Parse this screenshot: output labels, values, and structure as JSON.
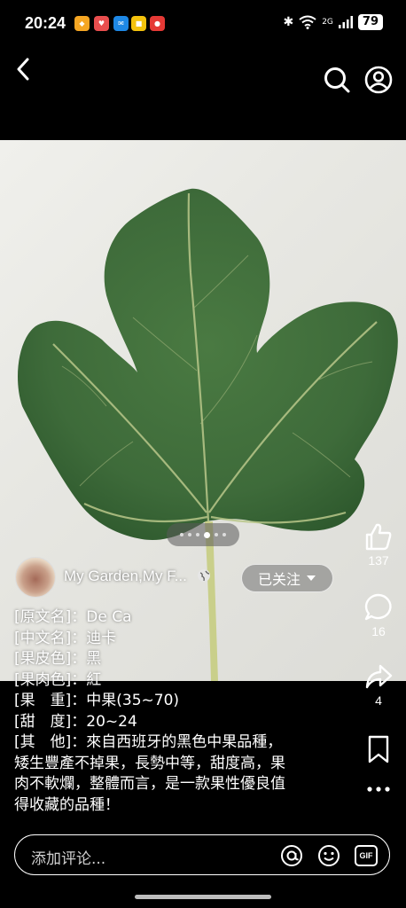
{
  "status": {
    "time": "20:24",
    "apps": [
      {
        "icon": "app-orange-icon",
        "color": "#f5a623",
        "glyph": "◆"
      },
      {
        "icon": "app-heart-icon",
        "color": "#e94e4e",
        "glyph": "♥"
      },
      {
        "icon": "messenger-icon",
        "color": "#1e88e5",
        "glyph": "✉"
      },
      {
        "icon": "app-yellow-icon",
        "color": "#f4c20d",
        "glyph": "■"
      },
      {
        "icon": "app-red-icon",
        "color": "#e53935",
        "glyph": "●"
      }
    ],
    "network": "2G",
    "battery": "79"
  },
  "post": {
    "author": "My Garden,My F...",
    "follow_label": "已关注",
    "page_count": 6,
    "active_page": 4
  },
  "caption": [
    "[原文名]：De Ca",
    "[中文名]：迪卡",
    "[果皮色]：黑",
    "[果肉色]：紅",
    "[果　重]：中果(35~70)",
    "[甜　度]：20~24",
    "[其　他]：來自西班牙的黑色中果品種，",
    "矮生豐產不掉果，長勢中等，甜度高，果",
    "肉不軟爛，整體而言，是一款果性優良值",
    "得收藏的品種！"
  ],
  "actions": {
    "likes": "137",
    "comments": "16",
    "shares": "4"
  },
  "comment_bar": {
    "placeholder": "添加评论...",
    "gif_label": "GIF"
  },
  "colors": {
    "leaf": "#3e6b3a",
    "background": "#000000"
  }
}
